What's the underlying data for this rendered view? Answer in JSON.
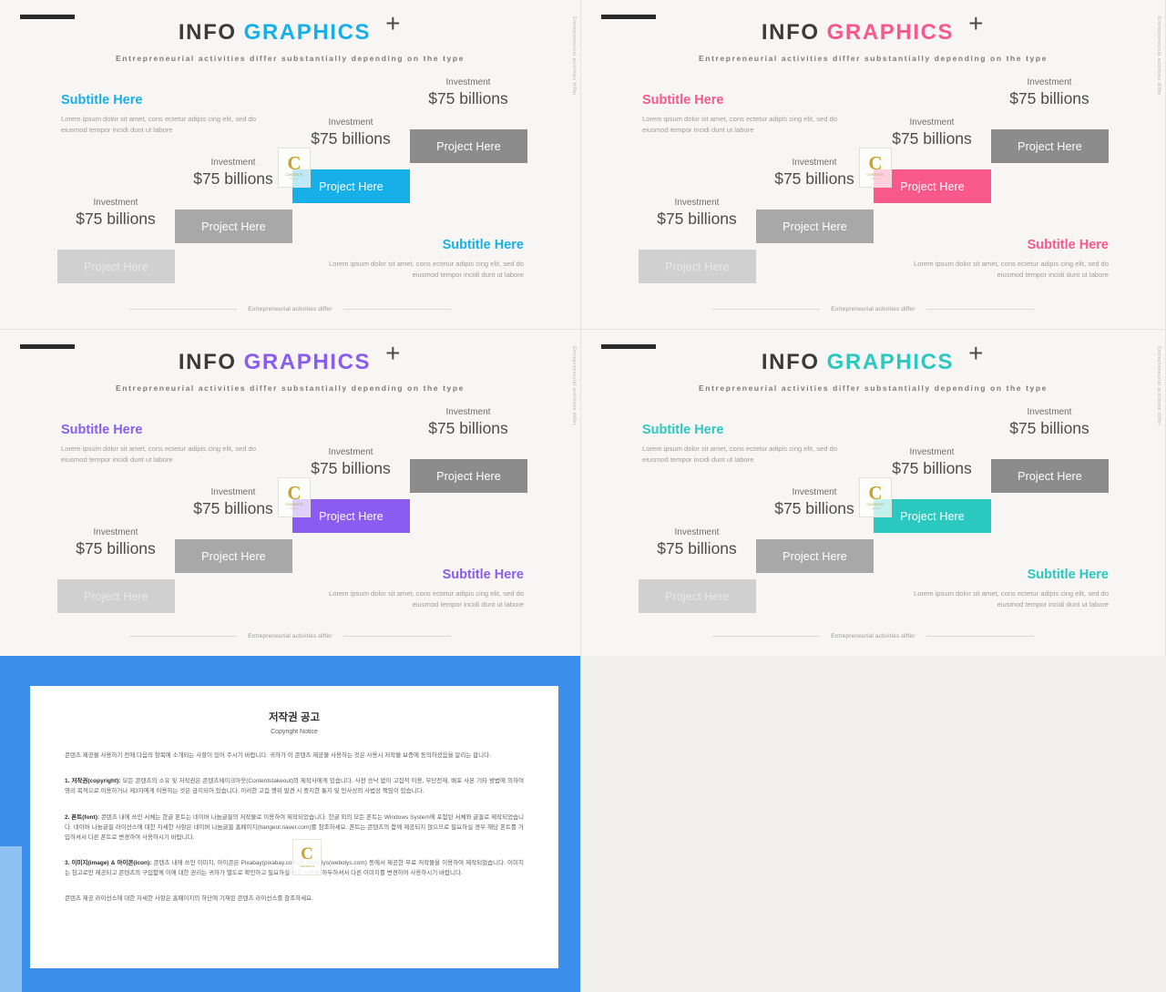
{
  "slides": [
    {
      "accent": "#17AFE8",
      "title_dark": "INFO",
      "title_accent": "GRAPHICS",
      "plus": "+",
      "subhead": "Entrepreneurial activities differ substantially depending on the type",
      "vlabel": "Entrepreneurial activities differ",
      "left_block": {
        "subtitle": "Subtitle Here",
        "paragraph": "Lorem ipsum dolor sit amet, cons ectetur adipis cing elit, sed do eiusmod tempor incidi dunt ut labore"
      },
      "right_block": {
        "subtitle": "Subtitle Here",
        "paragraph": "Lorem ipsum dolor sit amet, cons ectetur adipis cing elit, sed do eiusmod tempor incidi dunt ut labore"
      },
      "steps": [
        {
          "bar": "Project Here",
          "investment": "Investment",
          "amount": "$75 billions"
        },
        {
          "bar": "Project Here",
          "investment": "Investment",
          "amount": "$75 billions"
        },
        {
          "bar": "Project Here",
          "investment": "Investment",
          "amount": "$75 billions"
        },
        {
          "bar": "Project Here",
          "investment": "Investment",
          "amount": "$75 billions"
        }
      ],
      "footer": "Entrepreneurial activities differ",
      "watermark": {
        "letter": "C",
        "line1": "CONTENTS",
        "line2": "free ppt"
      }
    },
    {
      "accent": "#F9588C",
      "title_dark": "INFO",
      "title_accent": "GRAPHICS",
      "plus": "+",
      "subhead": "Entrepreneurial activities differ substantially depending on the type",
      "vlabel": "Entrepreneurial activities differ",
      "left_block": {
        "subtitle": "Subtitle Here",
        "paragraph": "Lorem ipsum dolor sit amet, cons ectetur adipis cing elit, sed do eiusmod tempor incidi dunt ut labore"
      },
      "right_block": {
        "subtitle": "Subtitle Here",
        "paragraph": "Lorem ipsum dolor sit amet, cons ectetur adipis cing elit, sed do eiusmod tempor incidi dunt ut labore"
      },
      "steps": [
        {
          "bar": "Project Here",
          "investment": "Investment",
          "amount": "$75 billions"
        },
        {
          "bar": "Project Here",
          "investment": "Investment",
          "amount": "$75 billions"
        },
        {
          "bar": "Project Here",
          "investment": "Investment",
          "amount": "$75 billions"
        },
        {
          "bar": "Project Here",
          "investment": "Investment",
          "amount": "$75 billions"
        }
      ],
      "footer": "Entrepreneurial activities differ",
      "watermark": {
        "letter": "C",
        "line1": "CONTENTS",
        "line2": "free ppt"
      }
    },
    {
      "accent": "#8B5CF0",
      "title_dark": "INFO",
      "title_accent": "GRAPHICS",
      "plus": "+",
      "subhead": "Entrepreneurial activities differ substantially depending on the type",
      "vlabel": "Entrepreneurial activities differ",
      "left_block": {
        "subtitle": "Subtitle Here",
        "paragraph": "Lorem ipsum dolor sit amet, cons ectetur adipis cing elit, sed do eiusmod tempor incidi dunt ut labore"
      },
      "right_block": {
        "subtitle": "Subtitle Here",
        "paragraph": "Lorem ipsum dolor sit amet, cons ectetur adipis cing elit, sed do eiusmod tempor incidi dunt ut labore"
      },
      "steps": [
        {
          "bar": "Project Here",
          "investment": "Investment",
          "amount": "$75 billions"
        },
        {
          "bar": "Project Here",
          "investment": "Investment",
          "amount": "$75 billions"
        },
        {
          "bar": "Project Here",
          "investment": "Investment",
          "amount": "$75 billions"
        },
        {
          "bar": "Project Here",
          "investment": "Investment",
          "amount": "$75 billions"
        }
      ],
      "footer": "Entrepreneurial activities differ",
      "watermark": {
        "letter": "C",
        "line1": "CONTENTS",
        "line2": "free ppt"
      }
    },
    {
      "accent": "#2BC8C0",
      "title_dark": "INFO",
      "title_accent": "GRAPHICS",
      "plus": "+",
      "subhead": "Entrepreneurial activities differ substantially depending on the type",
      "vlabel": "Entrepreneurial activities differ",
      "left_block": {
        "subtitle": "Subtitle Here",
        "paragraph": "Lorem ipsum dolor sit amet, cons ectetur adipis cing elit, sed do eiusmod tempor incidi dunt ut labore"
      },
      "right_block": {
        "subtitle": "Subtitle Here",
        "paragraph": "Lorem ipsum dolor sit amet, cons ectetur adipis cing elit, sed do eiusmod tempor incidi dunt ut labore"
      },
      "steps": [
        {
          "bar": "Project Here",
          "investment": "Investment",
          "amount": "$75 billions"
        },
        {
          "bar": "Project Here",
          "investment": "Investment",
          "amount": "$75 billions"
        },
        {
          "bar": "Project Here",
          "investment": "Investment",
          "amount": "$75 billions"
        },
        {
          "bar": "Project Here",
          "investment": "Investment",
          "amount": "$75 billions"
        }
      ],
      "footer": "Entrepreneurial activities differ",
      "watermark": {
        "letter": "C",
        "line1": "CONTENTS",
        "line2": "free ppt"
      }
    }
  ],
  "copyright_doc": {
    "frame_color": "#3B8FEA",
    "title": "저작권 공고",
    "subtitle": "Copyright Notice",
    "intro": "콘텐츠 제공물 사용하기 전에 다음의 항목에 소개되는 사항이 있어 주시기 바랍니다. 귀하가 이 콘텐츠 제공물 사용하는 것은 사용시 저작물 보증에 동의하셨음을 알리는 합니다.",
    "section1": {
      "heading": "1. 저작권(copyright):",
      "body": " 모든 콘텐츠의 소유 및 저작권은 콘텐츠메이크아웃(Contentstakeout)의 제작사에게 있습니다. 사전 승낙 없이 고집적 이용, 무단전재, 배포 사본 기타 방법에 의하여 영리 목적으로 이용하거나 제3자에게 이용하는 것은 금지되어 있습니다. 이러한 고집 행위 발견 시 중지한 통지 및 민사상의 사법상 책임이 있습니다."
    },
    "section2": {
      "heading": "2. 폰트(font):",
      "body": " 콘텐츠 내에 쓰인 서체는 한글 폰트는 네이버 나눔글꼴의 저작물로 이용하여 제작되었습니다. 한글 외의 모든 폰트는 Windows System에 포함된 서체와 글꼴로 제작되었습니다. 네이버 나눔글꼴 라이선스에 대한 자세한 사항은 네이버 나눔글꼴 홈페이지(hangeul.naver.com)를 참조하세요. 폰트는 콘텐츠의 함께 제공되지 않으므로 필요하실 경우 해당 폰트를 가입하셔서 다른 폰트로 변경하여 사용하시기 바랍니다."
    },
    "section3": {
      "heading": "3. 이미지(image) & 아이콘(icon):",
      "body": " 콘텐츠 내에 쓰인 이미지, 아이콘은 Pixabay(pixabay.com)와 Webolys(webolys.com) 등에서 제공한 무료 저작물을 이용하여 제작되었습니다. 이미지는 참고로만 제공되고 콘텐츠의 구입함께 이에 대한 권리는 귀하가 별도로 확인하고 필요하실 경우 사용을 하두하셔서 다른 이미지를 변경하여 사용하시기 바랍니다."
    },
    "outro": "콘텐츠 제공 라이선스에 대한 자세한 사항은 홈페이지의 하단에 기재된 콘텐츠 라이선스를 참조하세요.",
    "watermark": {
      "letter": "C",
      "line1": "CONTENTS"
    }
  }
}
